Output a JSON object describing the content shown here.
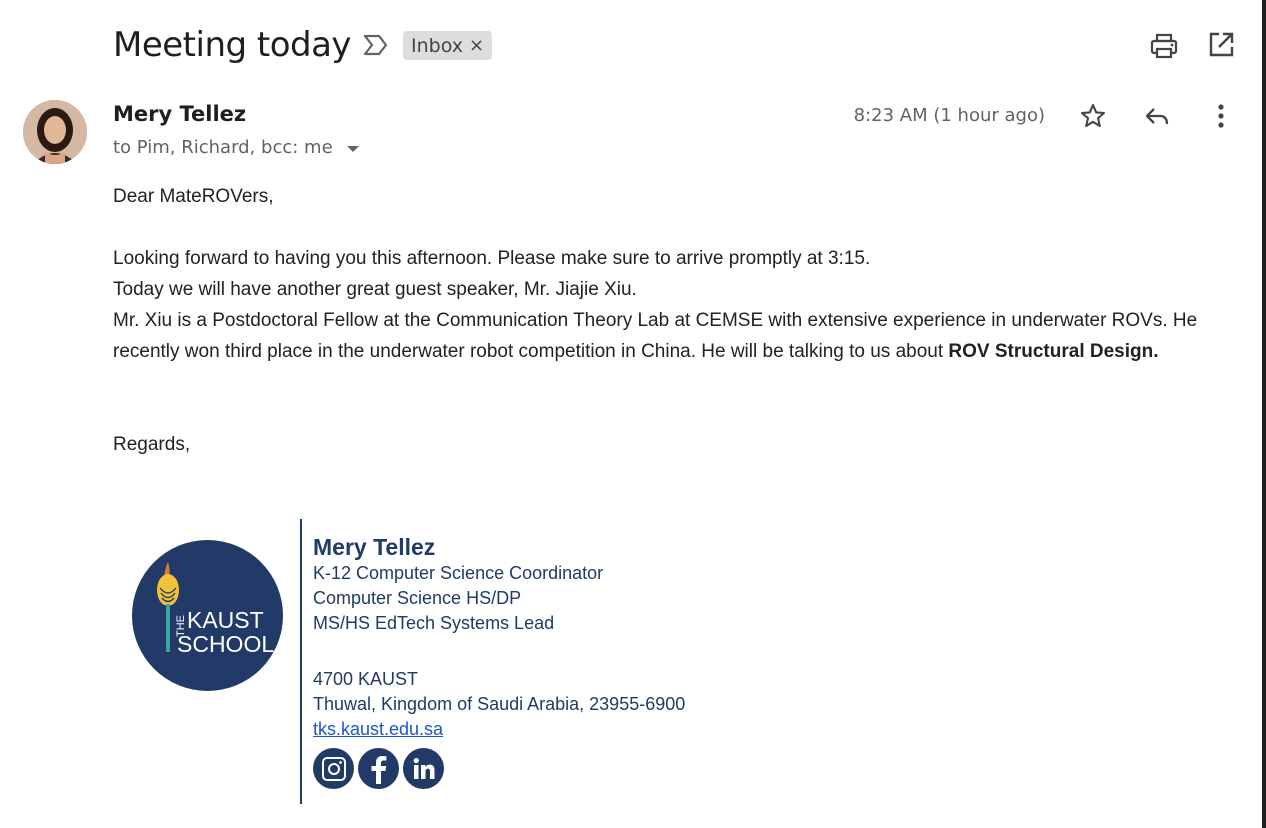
{
  "email": {
    "subject": "Meeting today",
    "label": "Inbox",
    "label_close": "×",
    "sender_name": "Mery Tellez",
    "recipients": "to Pim, Richard, bcc: me",
    "timestamp": "8:23 AM (1 hour ago)"
  },
  "body": {
    "greeting": "Dear MateROVers,",
    "line1": "Looking forward to having you this afternoon.  Please make sure to arrive promptly at 3:15.",
    "line2": "Today we will have another great guest speaker, Mr. Jiajie Xiu.",
    "line3_start": "Mr. Xiu is a Postdoctoral Fellow at the Communication Theory Lab at CEMSE with extensive experience in underwater ROVs.  He recently won third place in the underwater robot competition in China.  He will be talking to us about ",
    "line3_bold": "ROV Structural Design.",
    "closing": "Regards,"
  },
  "signature": {
    "name": "Mery Tellez",
    "title1": "K-12 Computer Science Coordinator",
    "title2": "Computer Science HS/DP",
    "title3": "MS/HS EdTech Systems Lead",
    "address1": "4700 KAUST",
    "address2": "Thuwal, Kingdom of Saudi Arabia, 23955-6900",
    "website": "tks.kaust.edu.sa",
    "logo_text": "THE KAUST SCHOOL",
    "social": [
      "instagram-icon",
      "facebook-icon",
      "linkedin-icon"
    ]
  },
  "colors": {
    "signature_navy": "#213a68",
    "link_blue": "#1a56c8",
    "chip_bg": "#dddddd"
  }
}
